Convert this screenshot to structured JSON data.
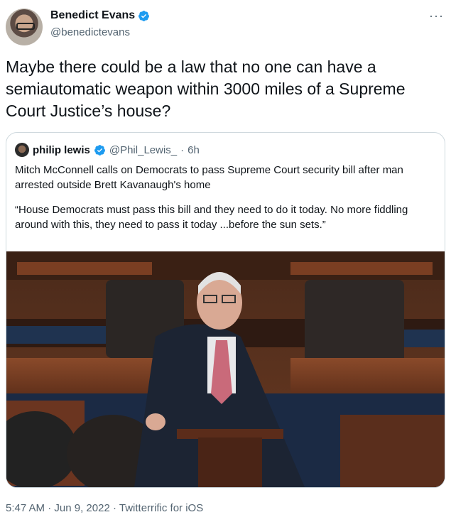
{
  "author": {
    "display_name": "Benedict Evans",
    "handle": "@benedictevans"
  },
  "more_icon": "more-horizontal-icon",
  "tweet": {
    "text": "Maybe there could be a law that no one can have a semiautomatic weapon within 3000 miles of a Supreme Court Justice’s house?"
  },
  "quoted": {
    "display_name": "philip lewis",
    "handle": "@Phil_Lewis_",
    "separator": "·",
    "time": "6h",
    "paragraph1": "Mitch McConnell calls on Democrats to pass Supreme Court security bill after man arrested outside Brett Kavanaugh's home",
    "paragraph2": "“House Democrats must pass this bill  and they need to do it today. No more fiddling around with this, they need to pass it today ...before the sun sets.”"
  },
  "footer": {
    "time": "5:47 AM",
    "sep1": "·",
    "date": "Jun 9, 2022",
    "sep2": "·",
    "source": "Twitterrific for iOS"
  },
  "colors": {
    "verified": "#1d9bf0",
    "secondary_text": "#536471",
    "border": "#cfd9de"
  }
}
